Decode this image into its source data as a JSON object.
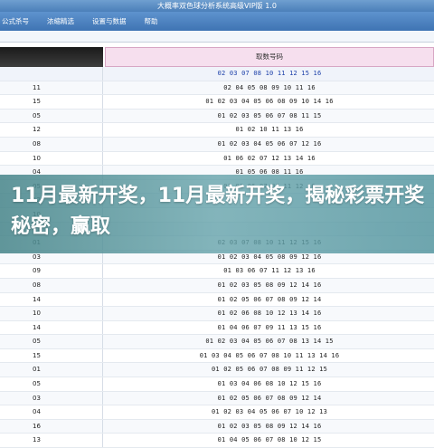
{
  "window": {
    "title": "大概率双色球分析系统高级VIP版 1.0"
  },
  "menu": {
    "items": [
      {
        "label": "公式杀号"
      },
      {
        "label": "浓缩精选"
      },
      {
        "label": "设置与数据"
      },
      {
        "label": "帮助"
      }
    ]
  },
  "table": {
    "header_right": "取数号码",
    "rows": [
      {
        "left": "",
        "numbers": "02 03 07 08 10 11 12 15 16"
      },
      {
        "left": "11",
        "numbers": "02 04 05 08 09 10 11 16"
      },
      {
        "left": "15",
        "numbers": "01 02 03 04 05 06 08 09 10 14 16"
      },
      {
        "left": "05",
        "numbers": "01 02 03 05 06 07 08 11 15"
      },
      {
        "left": "12",
        "numbers": "01 02 10 11 13 16"
      },
      {
        "left": "08",
        "numbers": "01 02 03 04 05 06 07 12 16"
      },
      {
        "left": "10",
        "numbers": "01 06 02 07 12 13 14 16"
      },
      {
        "left": "04",
        "numbers": "01 05 06 08 11 16"
      },
      {
        "left": "05",
        "numbers": "01 02 06 07 08 11 12 16"
      },
      {
        "left": "12",
        "numbers": ""
      },
      {
        "left": "10",
        "numbers": ""
      },
      {
        "left": "01",
        "numbers": ""
      },
      {
        "left": "01",
        "numbers": "02 03 07 08 10 11 12 15 16"
      },
      {
        "left": "03",
        "numbers": "01 02 03 04 05 08 09 12 16"
      },
      {
        "left": "09",
        "numbers": "01 03 06 07 11 12 13 16"
      },
      {
        "left": "08",
        "numbers": "01 02 03 05 08 09 12 14 16"
      },
      {
        "left": "14",
        "numbers": "01 02 05 06 07 08 09 12 14"
      },
      {
        "left": "10",
        "numbers": "01 02 06 08 10 12 13 14 16"
      },
      {
        "left": "14",
        "numbers": "01 04 06 07 09 11 13 15 16"
      },
      {
        "left": "05",
        "numbers": "01 02 03 04 05 06 07 08 13 14 15"
      },
      {
        "left": "15",
        "numbers": "01 03 04 05 06 07 08 10 11 13 14 16"
      },
      {
        "left": "01",
        "numbers": "01 02 05 06 07 08 09 11 12 15"
      },
      {
        "left": "05",
        "numbers": "01 03 04 06 08 10 12 15 16"
      },
      {
        "left": "03",
        "numbers": "01 02 05 06 07 08 09 12 14"
      },
      {
        "left": "04",
        "numbers": "01 02 03 04 05 06 07 10 12 13"
      },
      {
        "left": "16",
        "numbers": "01 02 03 05 08 09 12 14 16"
      },
      {
        "left": "13",
        "numbers": "01 04 05 06 07 08 10 12 15"
      }
    ]
  },
  "overlay": {
    "headline": "11月最新开奖，11月最新开奖，揭秘彩票开奖秘密，赢取"
  }
}
